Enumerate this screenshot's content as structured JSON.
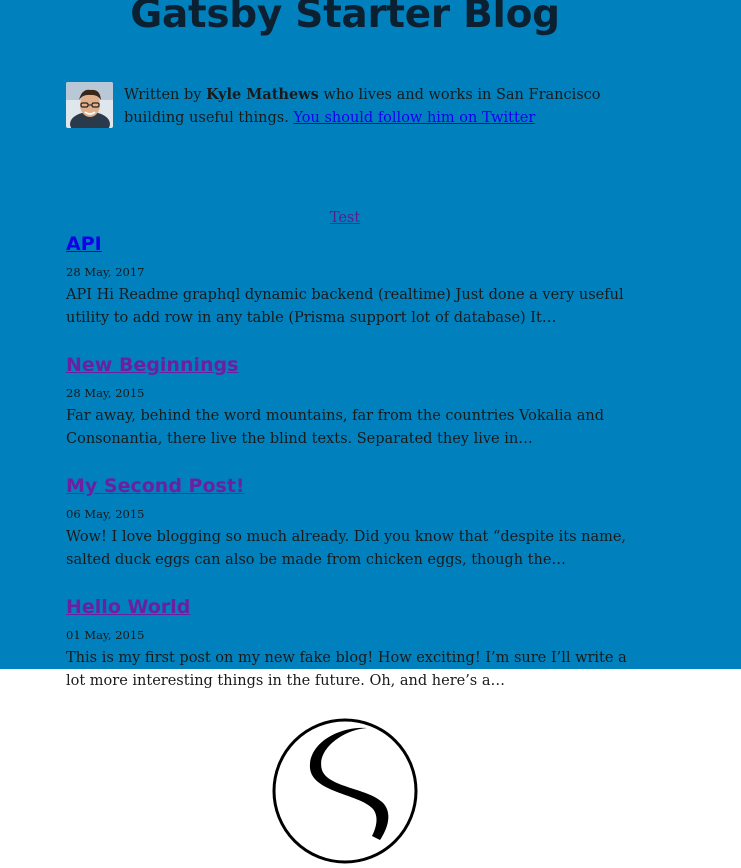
{
  "site": {
    "title": "Gatsby Starter Blog"
  },
  "bio": {
    "prefix": "Written by ",
    "author": "Kyle Mathews",
    "suffix": " who lives and works in San Francisco building useful things. ",
    "link_text": "You should follow him on Twitter"
  },
  "nav": {
    "test_link": "Test"
  },
  "posts": [
    {
      "title": "API",
      "date": "28 May, 2017",
      "excerpt": "API Hi Readme graphql dynamic backend (realtime) Just done a very useful utility to add row in any table (Prisma support lot of database) It…"
    },
    {
      "title": "New Beginnings",
      "date": "28 May, 2015",
      "excerpt": "Far away, behind the word mountains, far from the countries Vokalia and Consonantia, there live the blind texts. Separated they live in…"
    },
    {
      "title": "My Second Post!",
      "date": "06 May, 2015",
      "excerpt": "Wow! I love blogging so much already. Did you know that “despite its name, salted duck eggs can also be made from chicken eggs, though the…"
    },
    {
      "title": "Hello World",
      "date": "01 May, 2015",
      "excerpt": "This is my first post on my new fake blog! How exciting! I’m sure I’ll write a lot more interesting things in the future. Oh, and here’s a…"
    }
  ],
  "colors": {
    "background": "#0081bd",
    "title": "#0b2030",
    "link_unvisited": "#1300e8",
    "link_visited": "#6d1fa1"
  },
  "icons": {
    "avatar": "author-avatar",
    "logo": "gatsby-logo"
  }
}
